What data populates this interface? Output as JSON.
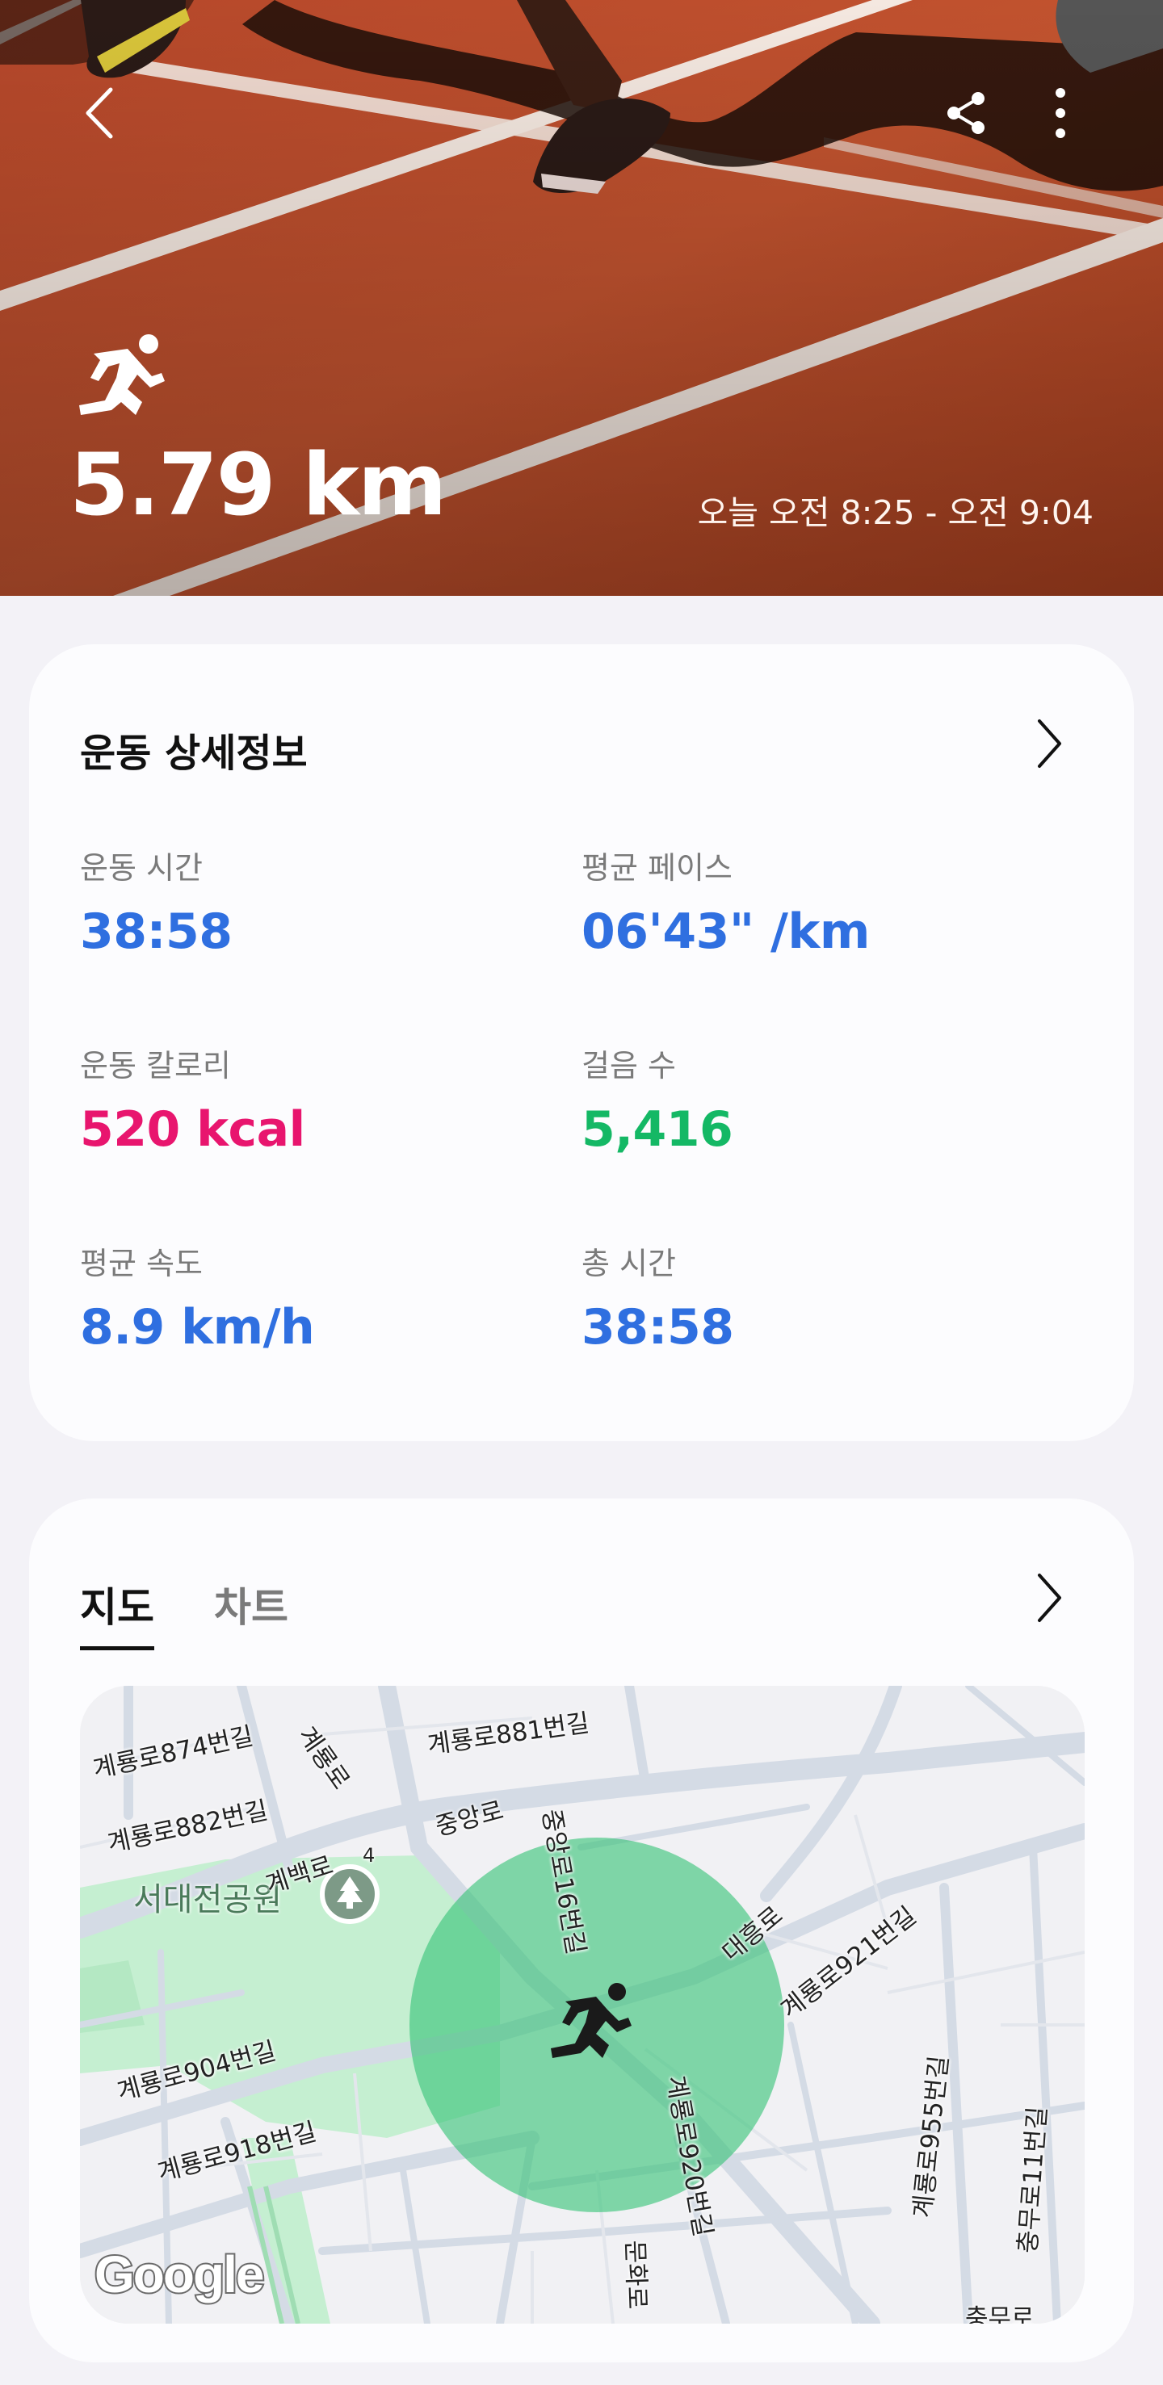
{
  "hero": {
    "distance": "5.79 km",
    "time_range": "오늘 오전 8:25 - 오전 9:04",
    "icons": {
      "back": "back-icon",
      "share": "share-icon",
      "more": "more-icon",
      "activity": "running-icon"
    }
  },
  "details": {
    "title": "운동 상세정보",
    "stats": [
      {
        "label": "운동 시간",
        "value": "38:58",
        "color": "#2f6fe0"
      },
      {
        "label": "평균 페이스",
        "value": "06'43\" /km",
        "color": "#2f6fe0"
      },
      {
        "label": "운동 칼로리",
        "value": "520 kcal",
        "color": "#e8156e"
      },
      {
        "label": "걸음 수",
        "value": "5,416",
        "color": "#14b865"
      },
      {
        "label": "평균 속도",
        "value": "8.9 km/h",
        "color": "#2f6fe0"
      },
      {
        "label": "총 시간",
        "value": "38:58",
        "color": "#2f6fe0"
      }
    ]
  },
  "map_section": {
    "tabs": [
      {
        "label": "지도",
        "active": true
      },
      {
        "label": "차트",
        "active": false
      }
    ],
    "park": "서대전공원",
    "streets": [
      "계룡로874번길",
      "계룡로",
      "계룡로881번길",
      "계룡로882번길",
      "중앙로",
      "계백로",
      "4",
      "중앙로16번길",
      "대흥로",
      "계룡로921번길",
      "계룡로904번길",
      "계룡로918번길",
      "계룡로920번길",
      "문화로",
      "계룡로955번길",
      "충무로11번길",
      "충무로"
    ],
    "attribution": "Google"
  }
}
